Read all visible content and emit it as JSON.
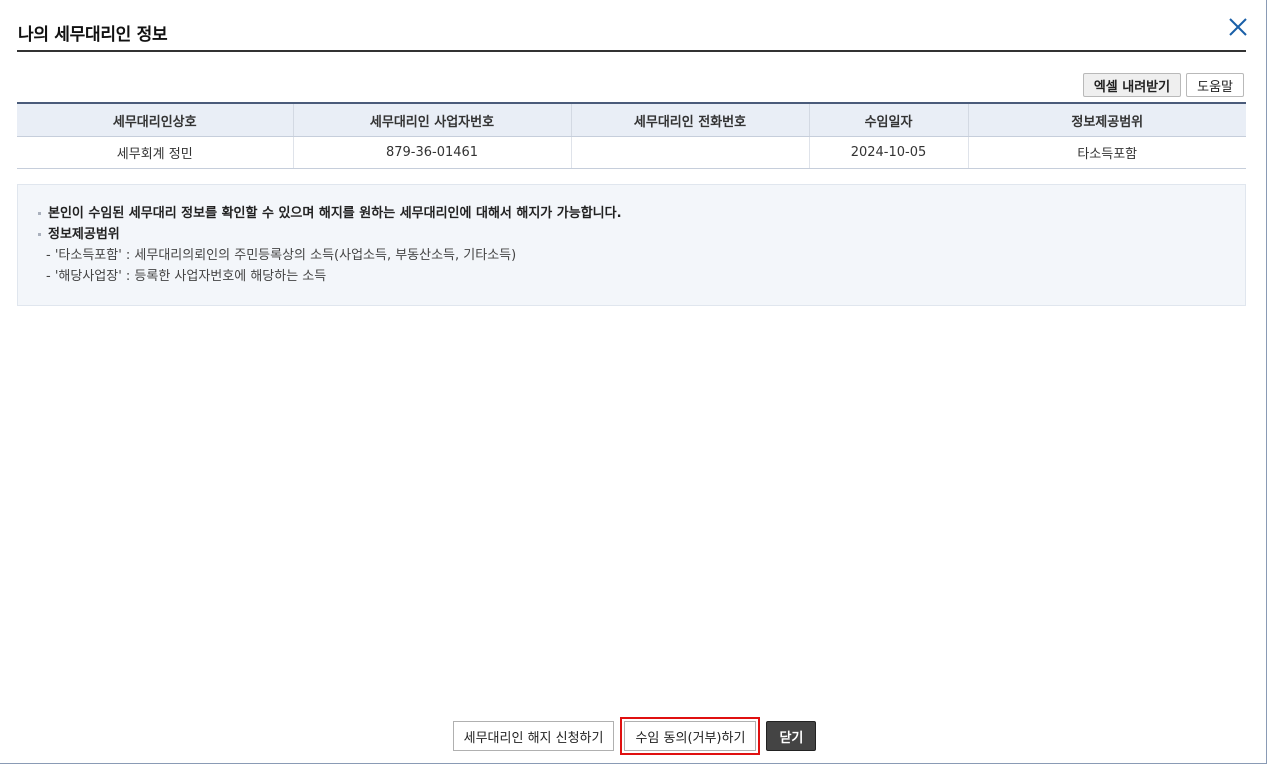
{
  "dialog": {
    "title": "나의 세무대리인 정보",
    "close_icon": "close-icon"
  },
  "toolbar": {
    "excel_label": "엑셀 내려받기",
    "help_label": "도움말"
  },
  "table": {
    "headers": [
      "세무대리인상호",
      "세무대리인 사업자번호",
      "세무대리인 전화번호",
      "수임일자",
      "정보제공범위"
    ],
    "rows": [
      [
        "세무회계 정민",
        "879-36-01461",
        "",
        "2024-10-05",
        "타소득포함"
      ]
    ]
  },
  "info": {
    "line1": "본인이 수임된 세무대리 정보를 확인할 수 있으며 해지를 원하는 세무대리인에 대해서 해지가 가능합니다.",
    "line2": "정보제공범위",
    "line3": "- '타소득포함' : 세무대리의뢰인의 주민등록상의 소득(사업소득, 부동산소득, 기타소득)",
    "line4": "- '해당사업장' : 등록한 사업자번호에 해당하는 소득"
  },
  "footer": {
    "cancel_label": "세무대리인 해지 신청하기",
    "consent_label": "수임 동의(거부)하기",
    "close_label": "닫기"
  },
  "colors": {
    "header_bg": "#e9eef6",
    "info_bg": "#f3f6fa",
    "highlight": "#e01010",
    "close_icon": "#1a5fa8"
  }
}
